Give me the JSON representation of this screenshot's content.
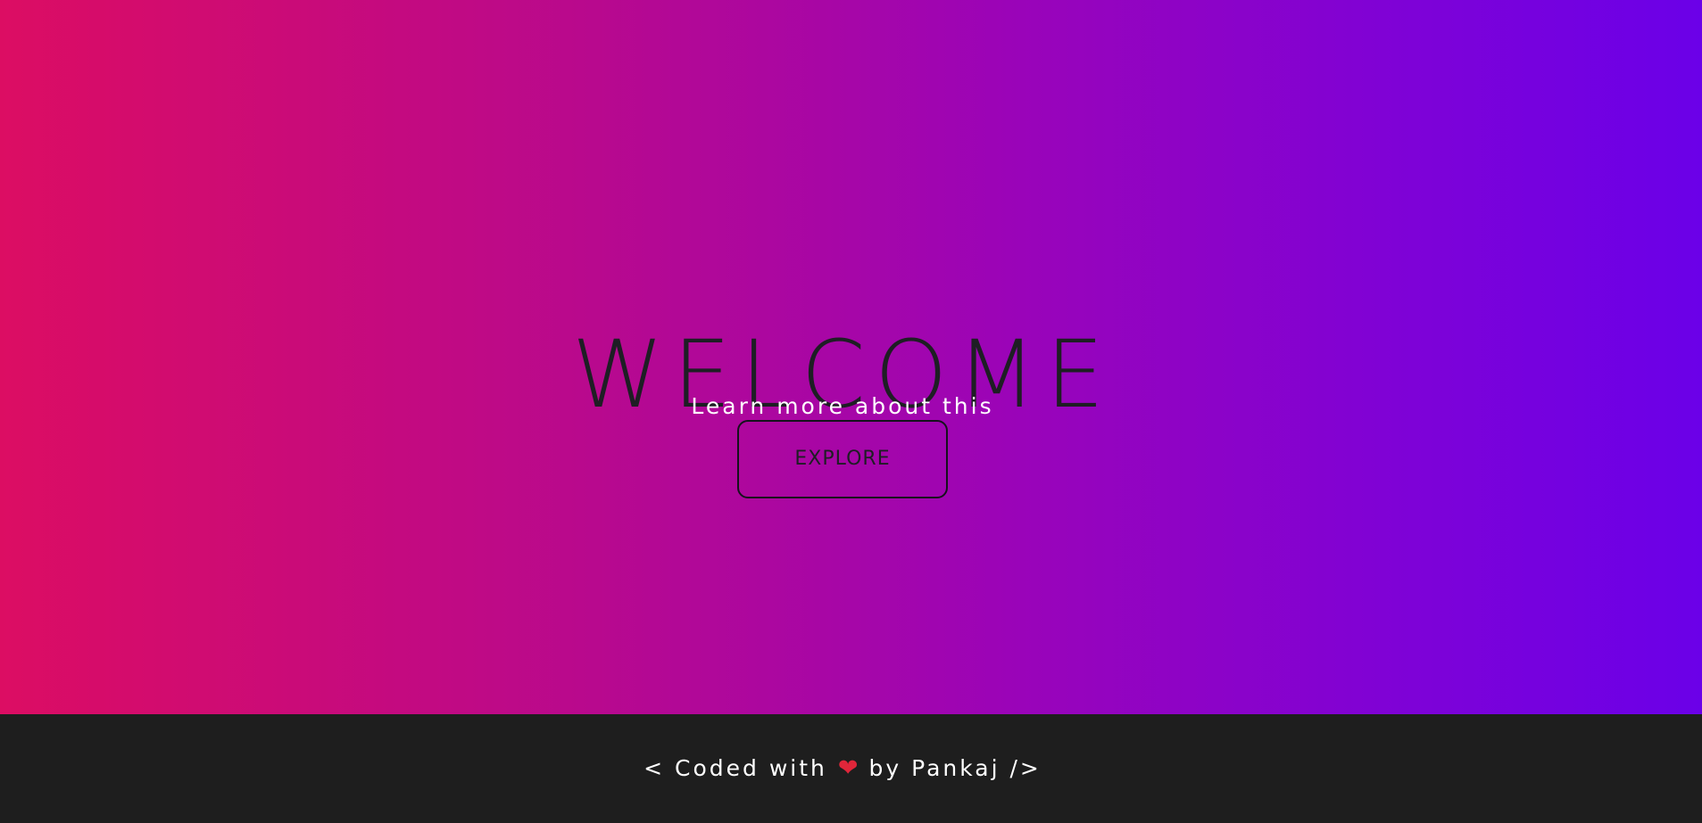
{
  "hero": {
    "title": "WELCOME",
    "subtitle": "Learn more about this",
    "button_label": "EXPLORE"
  },
  "footer": {
    "prefix": "< Coded with",
    "icon": "heart-icon",
    "heart_glyph": "❤",
    "suffix": "by Pankaj />"
  },
  "colors": {
    "gradient_start": "#dc0d63",
    "gradient_end": "#6b00e8",
    "footer_background": "#1e1e1e",
    "heart": "#e0263a"
  }
}
